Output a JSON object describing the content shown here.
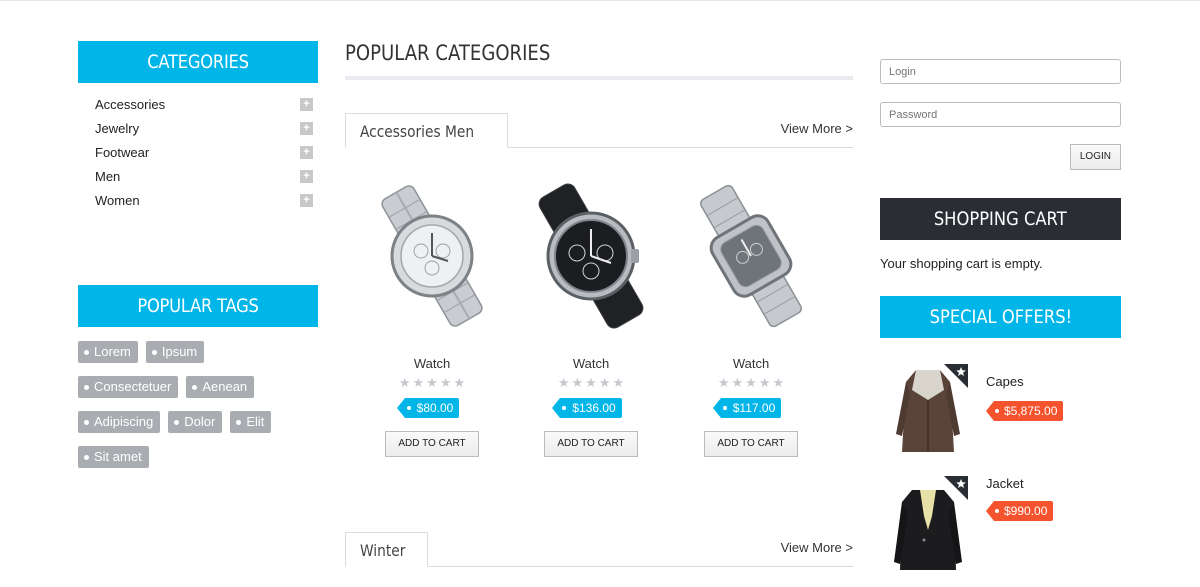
{
  "colors": {
    "accent": "#00b5e8",
    "dark": "#2a2d33",
    "tag_gray": "#a9adb1",
    "offer_price": "#f5532d"
  },
  "categories": {
    "title": "CATEGORIES",
    "items": [
      {
        "label": "Accessories",
        "icon": "plus-icon"
      },
      {
        "label": "Jewelry",
        "icon": "plus-icon"
      },
      {
        "label": "Footwear",
        "icon": "plus-icon"
      },
      {
        "label": "Men",
        "icon": "plus-icon"
      },
      {
        "label": "Women",
        "icon": "plus-icon"
      }
    ]
  },
  "popular_tags": {
    "title": "POPULAR TAGS",
    "items": [
      "Lorem",
      "Ipsum",
      "Consectetuer",
      "Aenean",
      "Adipiscing",
      "Dolor",
      "Elit",
      "Sit amet"
    ]
  },
  "main": {
    "title": "POPULAR CATEGORIES",
    "tabs": [
      {
        "label": "Accessories Men",
        "view_more": "View More >",
        "products": [
          {
            "name": "Watch",
            "price": "$80.00",
            "rating": 0,
            "button": "ADD TO CART",
            "image": "silver-watch"
          },
          {
            "name": "Watch",
            "price": "$136.00",
            "rating": 0,
            "button": "ADD TO CART",
            "image": "black-watch"
          },
          {
            "name": "Watch",
            "price": "$117.00",
            "rating": 0,
            "button": "ADD TO CART",
            "image": "square-silver-watch"
          }
        ]
      },
      {
        "label": "Winter",
        "view_more": "View More >"
      }
    ]
  },
  "login": {
    "login_placeholder": "Login",
    "password_placeholder": "Password",
    "button": "LOGIN"
  },
  "shopping_cart": {
    "title": "SHOPPING CART",
    "message": "Your shopping cart is empty."
  },
  "special_offers": {
    "title": "SPECIAL OFFERS!",
    "items": [
      {
        "name": "Capes",
        "price": "$5,875.00",
        "image": "brown-coat",
        "badge_icon": "star-icon"
      },
      {
        "name": "Jacket",
        "price": "$990.00",
        "image": "black-jacket",
        "badge_icon": "star-icon"
      }
    ]
  }
}
